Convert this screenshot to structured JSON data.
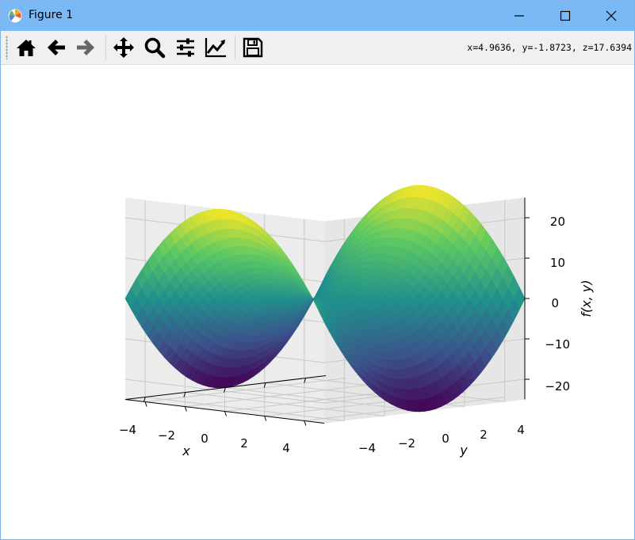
{
  "window": {
    "title": "Figure 1",
    "controls": {
      "minimize": "minimize",
      "maximize": "maximize",
      "close": "close"
    }
  },
  "toolbar": {
    "buttons": [
      {
        "name": "home-button",
        "icon": "home-icon"
      },
      {
        "name": "back-button",
        "icon": "arrow-left-icon"
      },
      {
        "name": "forward-button",
        "icon": "arrow-right-icon"
      },
      {
        "name": "pan-button",
        "icon": "move-icon"
      },
      {
        "name": "zoom-button",
        "icon": "magnifier-icon"
      },
      {
        "name": "subplots-button",
        "icon": "sliders-icon"
      },
      {
        "name": "edit-axes-button",
        "icon": "line-chart-icon"
      },
      {
        "name": "save-button",
        "icon": "floppy-icon"
      }
    ],
    "coords": "x=4.9636,  y=-1.8723,  z=17.6394"
  },
  "colors": {
    "titlebar": "#7bb8f6",
    "toolbar": "#f0f0f0"
  },
  "chart_data": {
    "type": "surface3d",
    "function": "f(x,y) = x^2 - y^2",
    "colormap": "viridis",
    "x": {
      "label": "x",
      "ticks": [
        "−4",
        "−2",
        "0",
        "2",
        "4"
      ],
      "range": [
        -5,
        5
      ]
    },
    "y": {
      "label": "y",
      "ticks": [
        "−4",
        "−2",
        "0",
        "2",
        "4"
      ],
      "range": [
        -5,
        5
      ]
    },
    "z": {
      "label": "f(x, y)",
      "ticks": [
        "20",
        "10",
        "0",
        "−10",
        "−20"
      ],
      "range": [
        -25,
        25
      ]
    },
    "grid": true
  }
}
